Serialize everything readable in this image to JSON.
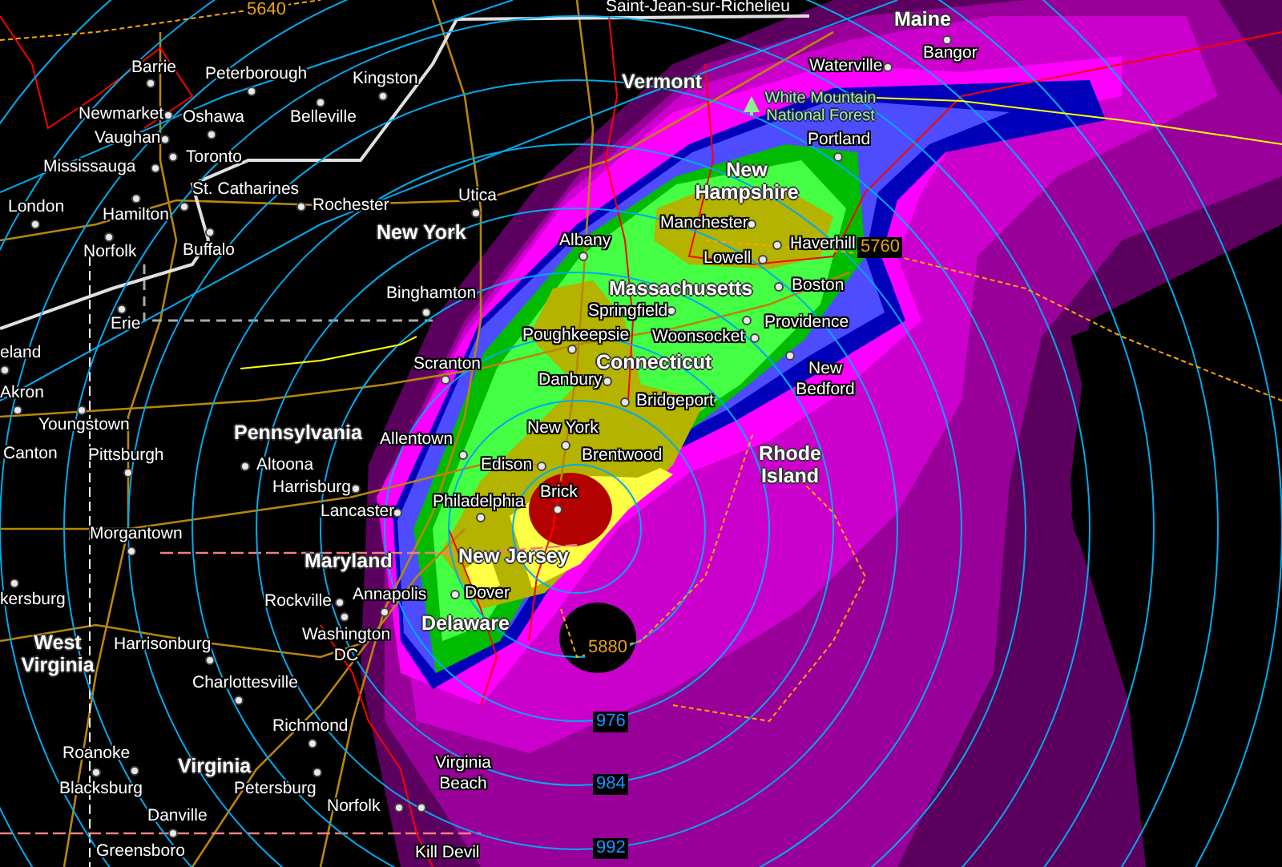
{
  "map": {
    "cities": [
      {
        "name": "Saint-Jean-sur-Richelieu"
      },
      {
        "name": "Bangor"
      },
      {
        "name": "Barrie"
      },
      {
        "name": "Peterborough"
      },
      {
        "name": "Kingston"
      },
      {
        "name": "Waterville"
      },
      {
        "name": "Newmarket"
      },
      {
        "name": "Oshawa"
      },
      {
        "name": "Belleville"
      },
      {
        "name": "Vaughan"
      },
      {
        "name": "Portland"
      },
      {
        "name": "Mississauga"
      },
      {
        "name": "Toronto"
      },
      {
        "name": "St. Catharines"
      },
      {
        "name": "Utica"
      },
      {
        "name": "London"
      },
      {
        "name": "Hamilton"
      },
      {
        "name": "Rochester"
      },
      {
        "name": "Manchester"
      },
      {
        "name": "Norfolk"
      },
      {
        "name": "Buffalo"
      },
      {
        "name": "Albany"
      },
      {
        "name": "Haverhill"
      },
      {
        "name": "Lowell"
      },
      {
        "name": "Binghamton"
      },
      {
        "name": "Boston"
      },
      {
        "name": "Erie"
      },
      {
        "name": "Springfield"
      },
      {
        "name": "Poughkeepsie"
      },
      {
        "name": "Woonsocket"
      },
      {
        "name": "Providence"
      },
      {
        "name": "eland"
      },
      {
        "name": "Scranton"
      },
      {
        "name": "Akron"
      },
      {
        "name": "Danbury"
      },
      {
        "name": "New Bedford"
      },
      {
        "name": "Bridgeport"
      },
      {
        "name": "Youngstown"
      },
      {
        "name": "Allentown"
      },
      {
        "name": "New York"
      },
      {
        "name": "Canton"
      },
      {
        "name": "Pittsburgh"
      },
      {
        "name": "Altoona"
      },
      {
        "name": "Edison"
      },
      {
        "name": "Brentwood"
      },
      {
        "name": "Harrisburg"
      },
      {
        "name": "Lancaster"
      },
      {
        "name": "Philadelphia"
      },
      {
        "name": "Brick"
      },
      {
        "name": "Morgantown"
      },
      {
        "name": "kersburg"
      },
      {
        "name": "Rockville"
      },
      {
        "name": "Annapolis"
      },
      {
        "name": "Dover"
      },
      {
        "name": "Harrisonburg"
      },
      {
        "name": "Washington DC"
      },
      {
        "name": "Charlottesville"
      },
      {
        "name": "Richmond"
      },
      {
        "name": "Roanoke"
      },
      {
        "name": "Blacksburg"
      },
      {
        "name": "Petersburg"
      },
      {
        "name": "Virginia Beach"
      },
      {
        "name": "Danville"
      },
      {
        "name": "Norfolk"
      },
      {
        "name": "Greensboro"
      },
      {
        "name": "Kill Devil"
      }
    ],
    "states": [
      "Maine",
      "Vermont",
      "New Hampshire",
      "New York",
      "Massachusetts",
      "Connecticut",
      "Pennsylvania",
      "Rhode Island",
      "New Jersey",
      "Maryland",
      "Delaware",
      "West Virginia",
      "Virginia"
    ],
    "park": {
      "name": "White Mountain National Forest"
    },
    "contour_labels": [
      {
        "text": "5640",
        "kind": "height"
      },
      {
        "text": "5760",
        "kind": "height"
      },
      {
        "text": "5880",
        "kind": "height"
      },
      {
        "text": "976",
        "kind": "pressure"
      },
      {
        "text": "984",
        "kind": "pressure"
      },
      {
        "text": "992",
        "kind": "pressure"
      }
    ]
  }
}
